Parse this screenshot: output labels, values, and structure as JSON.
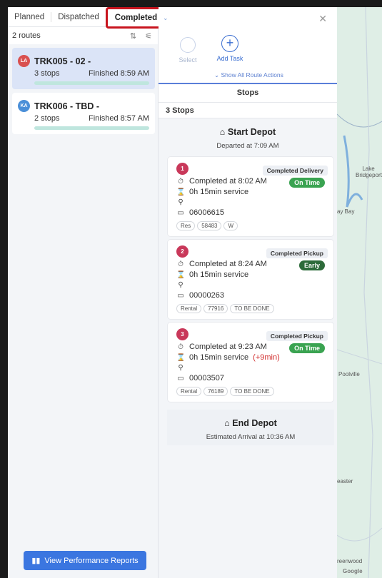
{
  "tabs": [
    "Planned",
    "Dispatched",
    "Completed"
  ],
  "routes_count": "2 routes",
  "routes": [
    {
      "initials": "LA",
      "color": "#d9504f",
      "name": "TRK005 - 02 -",
      "stops": "3 stops",
      "finished": "Finished 8:59 AM"
    },
    {
      "initials": "KA",
      "color": "#4a8fd8",
      "name": "TRK006 - TBD -",
      "stops": "2 stops",
      "finished": "Finished 8:57 AM"
    }
  ],
  "perf_button": "View Performance Reports",
  "actions": {
    "select": "Select",
    "add": "Add Task",
    "show_all": "Show All Route Actions"
  },
  "stops_title": "Stops",
  "stops_count": "3 Stops",
  "start_depot": {
    "name": "Start Depot",
    "sub": "Departed at 7:09 AM"
  },
  "end_depot": {
    "name": "End Depot",
    "sub": "Estimated Arrival at 10:36 AM"
  },
  "stops": [
    {
      "num": "1",
      "type": "Completed Delivery",
      "completed": "Completed at 8:02 AM",
      "status": "On Time",
      "service": "0h 15min service",
      "extra": "",
      "order": "06006615",
      "tags": [
        "Res",
        "58483",
        "W"
      ]
    },
    {
      "num": "2",
      "type": "Completed Pickup",
      "completed": "Completed at 8:24 AM",
      "status": "Early",
      "service": "0h 15min service",
      "extra": "",
      "order": "00000263",
      "tags": [
        "Rental",
        "77916",
        "TO BE DONE"
      ]
    },
    {
      "num": "3",
      "type": "Completed Pickup",
      "completed": "Completed at 9:23 AM",
      "status": "On Time",
      "service": "0h 15min service",
      "extra": "(+9min)",
      "order": "00003507",
      "tags": [
        "Rental",
        "76189",
        "TO BE DONE"
      ]
    }
  ],
  "map_labels": [
    "Lake Bridgeport",
    "ay Bay",
    "Poolville",
    "easter",
    "reenwood",
    "Google"
  ]
}
